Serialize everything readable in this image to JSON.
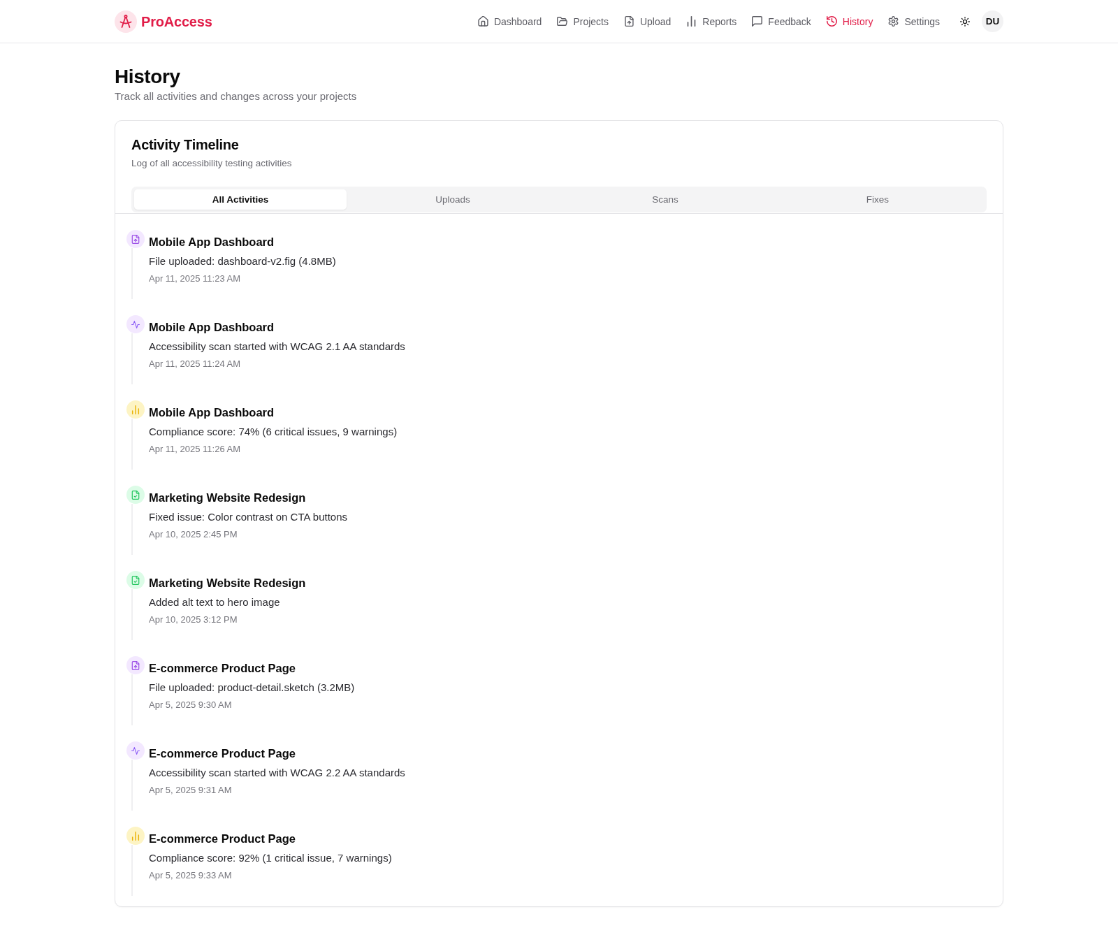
{
  "header": {
    "brand": "ProAccess",
    "nav": [
      {
        "label": "Dashboard",
        "selected": false
      },
      {
        "label": "Projects",
        "selected": false
      },
      {
        "label": "Upload",
        "selected": false
      },
      {
        "label": "Reports",
        "selected": false
      },
      {
        "label": "Feedback",
        "selected": false
      },
      {
        "label": "History",
        "selected": true
      },
      {
        "label": "Settings",
        "selected": false
      }
    ],
    "avatar": "DU"
  },
  "page": {
    "title": "History",
    "subtitle": "Track all activities and changes across your projects"
  },
  "timeline_card": {
    "title": "Activity Timeline",
    "subtitle": "Log of all accessibility testing activities",
    "tabs": [
      {
        "label": "All Activities",
        "selected": true
      },
      {
        "label": "Uploads",
        "selected": false
      },
      {
        "label": "Scans",
        "selected": false
      },
      {
        "label": "Fixes",
        "selected": false
      }
    ],
    "activities": [
      {
        "kind": "upload",
        "project": "Mobile App Dashboard",
        "description": "File uploaded: dashboard-v2.fig (4.8MB)",
        "time": "Apr 11, 2025 11:23 AM"
      },
      {
        "kind": "scan",
        "project": "Mobile App Dashboard",
        "description": "Accessibility scan started with WCAG 2.1 AA standards",
        "time": "Apr 11, 2025 11:24 AM"
      },
      {
        "kind": "score",
        "project": "Mobile App Dashboard",
        "description": "Compliance score: 74% (6 critical issues, 9 warnings)",
        "time": "Apr 11, 2025 11:26 AM"
      },
      {
        "kind": "fix",
        "project": "Marketing Website Redesign",
        "description": "Fixed issue: Color contrast on CTA buttons",
        "time": "Apr 10, 2025 2:45 PM"
      },
      {
        "kind": "fix",
        "project": "Marketing Website Redesign",
        "description": "Added alt text to hero image",
        "time": "Apr 10, 2025 3:12 PM"
      },
      {
        "kind": "upload",
        "project": "E-commerce Product Page",
        "description": "File uploaded: product-detail.sketch (3.2MB)",
        "time": "Apr 5, 2025 9:30 AM"
      },
      {
        "kind": "scan",
        "project": "E-commerce Product Page",
        "description": "Accessibility scan started with WCAG 2.2 AA standards",
        "time": "Apr 5, 2025 9:31 AM"
      },
      {
        "kind": "score",
        "project": "E-commerce Product Page",
        "description": "Compliance score: 92% (1 critical issue, 7 warnings)",
        "time": "Apr 5, 2025 9:33 AM"
      }
    ]
  }
}
